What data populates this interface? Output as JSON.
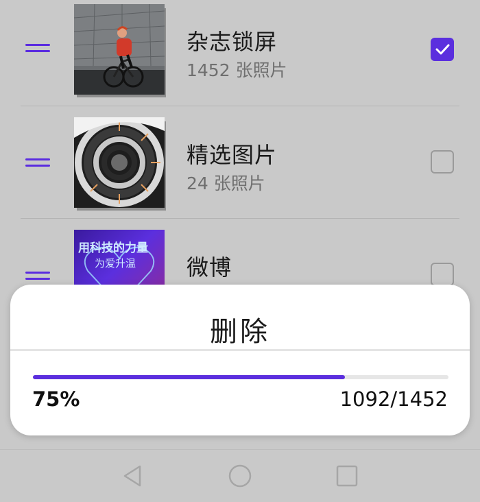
{
  "albums": [
    {
      "title": "杂志锁屏",
      "count": "1452 张照片",
      "checked": true,
      "thumb_icon": "cyclist-photo-thumbnail"
    },
    {
      "title": "精选图片",
      "count": "24 张照片",
      "checked": false,
      "thumb_icon": "spiral-staircase-photo-thumbnail"
    },
    {
      "title": "微博",
      "count": "",
      "checked": false,
      "thumb_icon": "promo-banner-thumbnail"
    }
  ],
  "thumb3_text": {
    "line1": "用科技的力量",
    "line2": "为爱升温"
  },
  "dialog": {
    "title": "删除",
    "progress_percent": "75%",
    "progress_count": "1092/1452",
    "progress_fraction": 0.75
  },
  "colors": {
    "accent": "#5b2fde",
    "background_dim": "#c9c9c9",
    "dialog_bg": "#ffffff"
  },
  "nav": [
    "back-icon",
    "home-icon",
    "recents-icon"
  ]
}
